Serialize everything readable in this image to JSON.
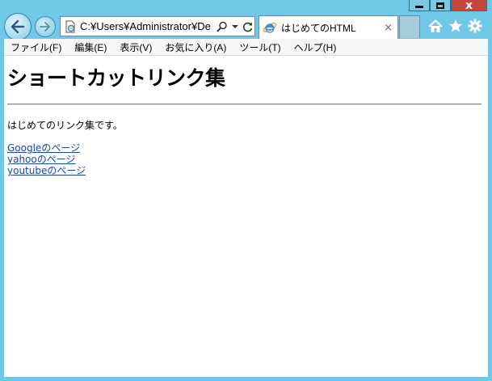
{
  "window": {
    "min_label": "",
    "close_label": "x"
  },
  "address_bar": {
    "url": "C:¥Users¥Administrator¥De"
  },
  "tab": {
    "title": "はじめてのHTML",
    "close": "×"
  },
  "menu": {
    "items": [
      "ファイル(F)",
      "編集(E)",
      "表示(V)",
      "お気に入り(A)",
      "ツール(T)",
      "ヘルプ(H)"
    ]
  },
  "page": {
    "heading": "ショートカットリンク集",
    "intro": "はじめてのリンク集です。",
    "links": [
      "Googleのページ",
      "yahooのページ",
      "youtubeのページ"
    ]
  },
  "colors": {
    "frame": "#6ec8e6",
    "close_button": "#c7463b",
    "link": "#1a46a8"
  }
}
